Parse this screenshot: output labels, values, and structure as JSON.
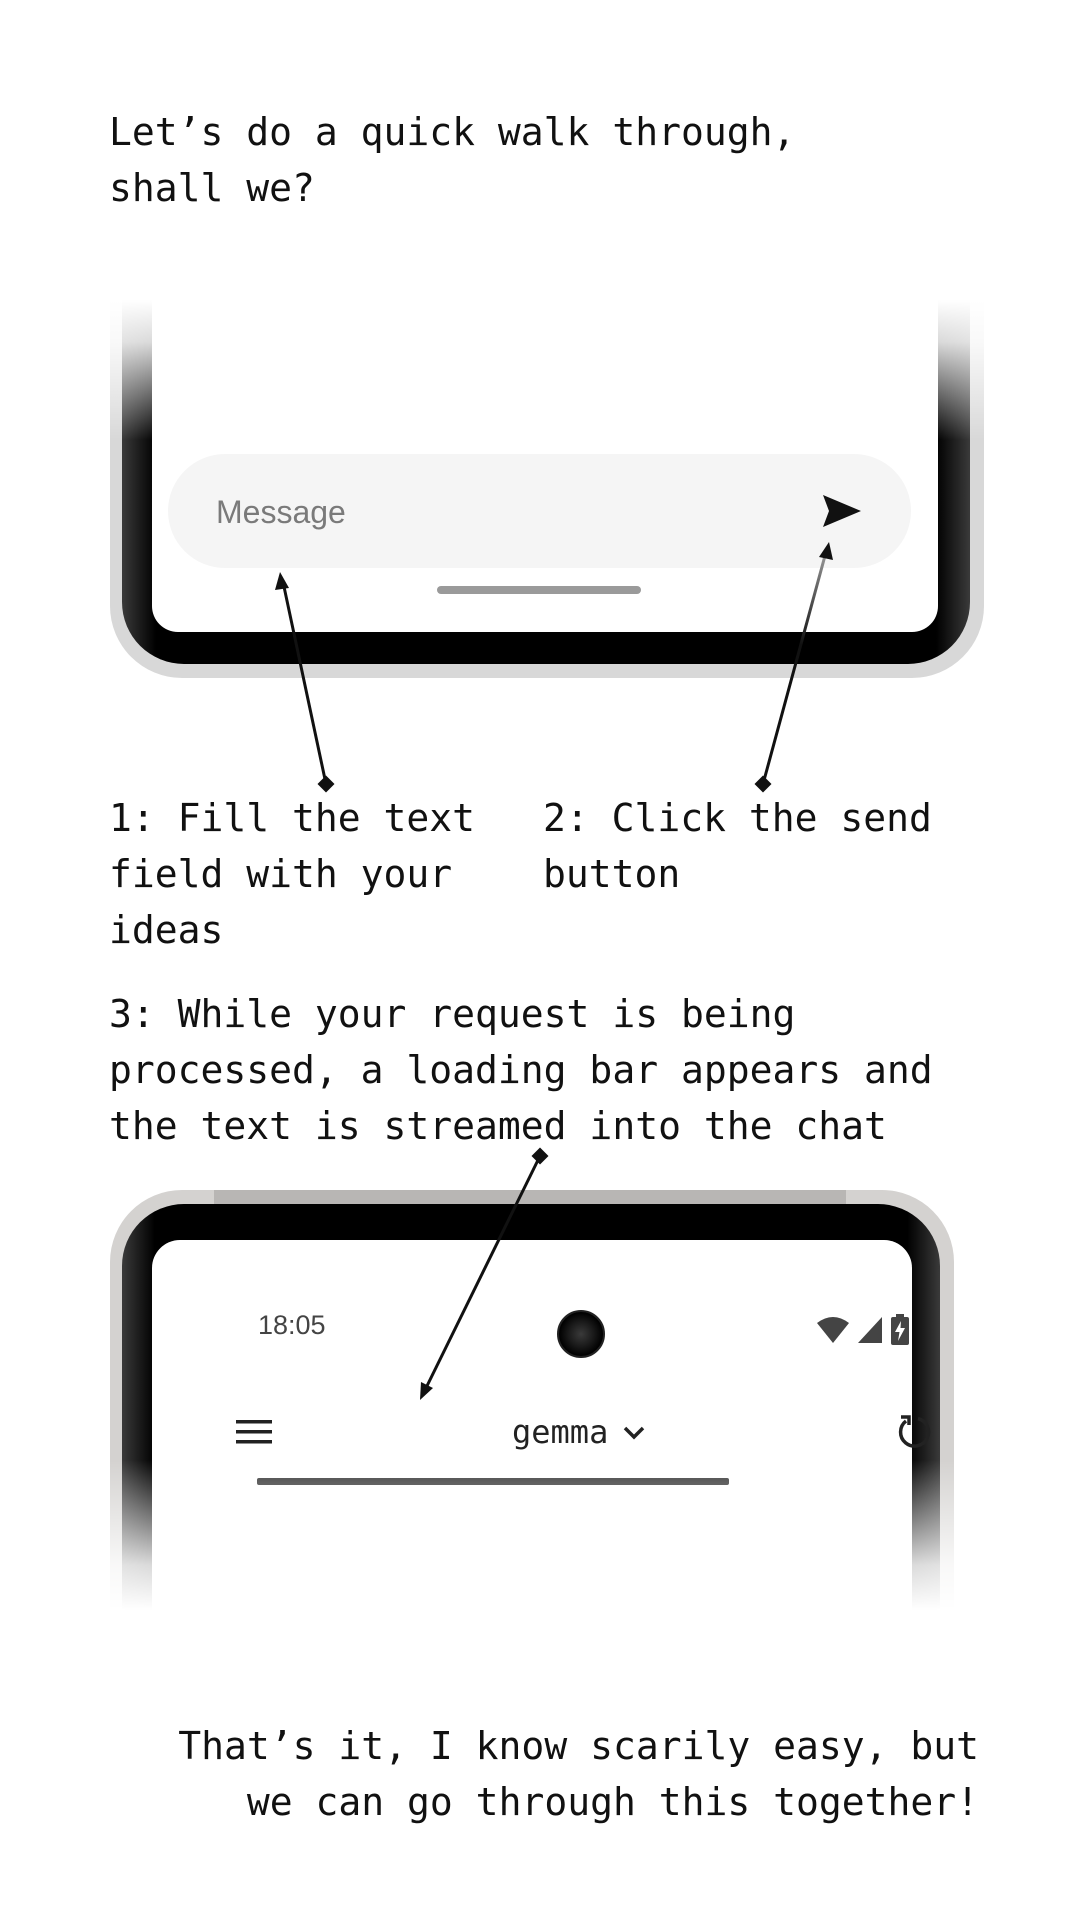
{
  "intro_text": "Let’s do a quick walk through, shall we?",
  "steps": [
    {
      "text": "1: Fill the text field with your ideas"
    },
    {
      "text": "2: Click the send button"
    },
    {
      "text": "3: While your request is being processed, a loading bar appears and the text is streamed into the chat"
    }
  ],
  "outro_text": "That’s it, I know scarily easy, but\nwe can go through this together!",
  "chat_input": {
    "placeholder": "Message",
    "value": ""
  },
  "send_button": {
    "icon": "send-icon"
  },
  "status_bar": {
    "time": "18:05",
    "icons": [
      "wifi-icon",
      "signal-icon",
      "battery-charging-icon"
    ]
  },
  "app_bar": {
    "menu_icon": "menu-icon",
    "model_name": "gemma",
    "dropdown_icon": "chevron-down-icon",
    "refresh_icon": "refresh-icon"
  },
  "loading": {
    "state": "in-progress"
  },
  "colors": {
    "text": "#111111",
    "input_background": "#f5f5f5",
    "placeholder": "#7a7a7a",
    "loading_bar": "#3c3c3c",
    "phone_bezel": "#000000",
    "phone_case": "#d8d8d8"
  }
}
